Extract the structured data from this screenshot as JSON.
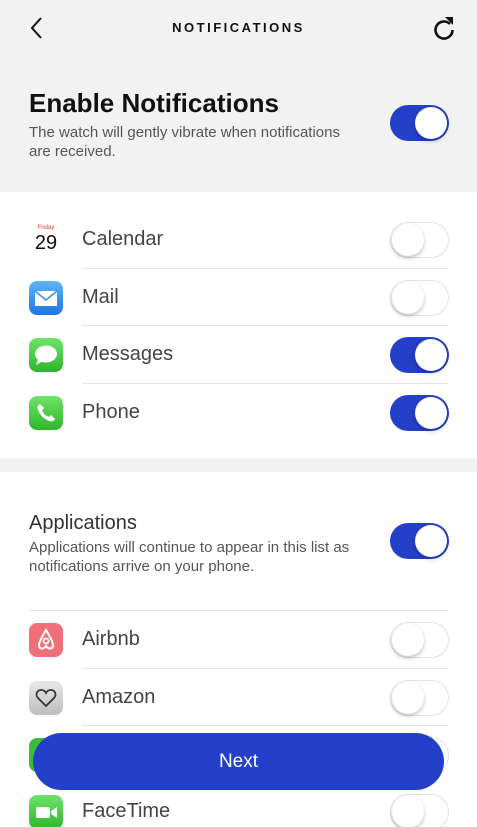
{
  "header": {
    "title": "NOTIFICATIONS",
    "back_icon": "chevron-left-icon",
    "refresh_icon": "refresh-icon"
  },
  "enable": {
    "title": "Enable Notifications",
    "description": "The watch will gently vibrate when notifications are received.",
    "on": true
  },
  "system_apps": [
    {
      "label": "Calendar",
      "icon": "calendar-icon",
      "icon_day": "Friday",
      "icon_date": "29",
      "on": false
    },
    {
      "label": "Mail",
      "icon": "mail-icon",
      "on": false
    },
    {
      "label": "Messages",
      "icon": "messages-icon",
      "on": true
    },
    {
      "label": "Phone",
      "icon": "phone-icon",
      "on": true
    }
  ],
  "applications": {
    "title": "Applications",
    "description": "Applications will continue to appear in this list as notifications arrive on your phone.",
    "on": true,
    "items": [
      {
        "label": "Airbnb",
        "icon": "airbnb-icon",
        "on": false
      },
      {
        "label": "Amazon",
        "icon": "amazon-icon",
        "on": false
      },
      {
        "label": "",
        "icon": "app-icon",
        "on": false
      },
      {
        "label": "FaceTime",
        "icon": "facetime-icon",
        "on": false
      }
    ]
  },
  "next_button": {
    "label": "Next"
  },
  "colors": {
    "accent": "#2440c8",
    "header_bg": "#f2f2f2"
  }
}
